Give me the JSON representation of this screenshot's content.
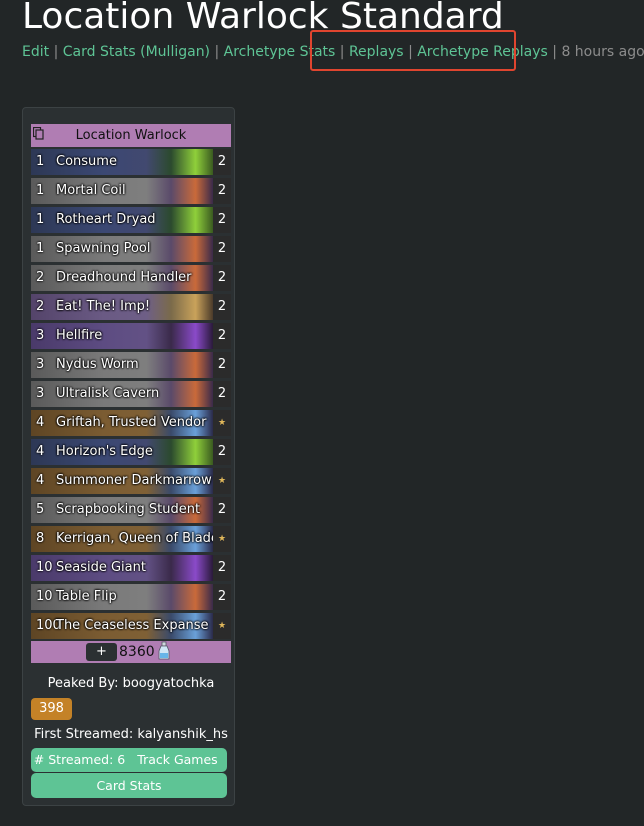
{
  "page": {
    "title": "Location Warlock Standard"
  },
  "links": {
    "edit": "Edit",
    "card_stats_mulligan": "Card Stats (Mulligan)",
    "archetype_stats": "Archetype Stats",
    "replays": "Replays",
    "archetype_replays": "Archetype Replays",
    "age": "8 hours ago",
    "separator": "|"
  },
  "deck": {
    "name": "Location Warlock",
    "copy_icon": "copy-icon",
    "cards": [
      {
        "cost": "1",
        "name": "Consume",
        "count": "2",
        "style": "warlock"
      },
      {
        "cost": "1",
        "name": "Mortal Coil",
        "count": "2",
        "style": "neutral"
      },
      {
        "cost": "1",
        "name": "Rotheart Dryad",
        "count": "2",
        "style": "warlock"
      },
      {
        "cost": "1",
        "name": "Spawning Pool",
        "count": "2",
        "style": "neutral"
      },
      {
        "cost": "2",
        "name": "Dreadhound Handler",
        "count": "2",
        "style": "neutral"
      },
      {
        "cost": "2",
        "name": "Eat! The! Imp!",
        "count": "2",
        "style": "zerg"
      },
      {
        "cost": "3",
        "name": "Hellfire",
        "count": "2",
        "style": "purple"
      },
      {
        "cost": "3",
        "name": "Nydus Worm",
        "count": "2",
        "style": "neutral"
      },
      {
        "cost": "3",
        "name": "Ultralisk Cavern",
        "count": "2",
        "style": "neutral"
      },
      {
        "cost": "4",
        "name": "Griftah, Trusted Vendor",
        "count": "★",
        "style": "legbar"
      },
      {
        "cost": "4",
        "name": "Horizon's Edge",
        "count": "2",
        "style": "warlock"
      },
      {
        "cost": "4",
        "name": "Summoner Darkmarrow",
        "count": "★",
        "style": "legbar"
      },
      {
        "cost": "5",
        "name": "Scrapbooking Student",
        "count": "2",
        "style": "neutral"
      },
      {
        "cost": "8",
        "name": "Kerrigan, Queen of Blades",
        "count": "★",
        "style": "legbar"
      },
      {
        "cost": "10",
        "name": "Seaside Giant",
        "count": "2",
        "style": "purple"
      },
      {
        "cost": "10",
        "name": "Table Flip",
        "count": "2",
        "style": "neutral"
      },
      {
        "cost": "100",
        "name": "The Ceaseless Expanse",
        "count": "★",
        "style": "legbar"
      }
    ],
    "add_button": "+",
    "dust_cost": "8360",
    "dust_icon": "dust-bottle-icon"
  },
  "stats": {
    "peaked_by": "Peaked By: boogyatochka",
    "rank": "398",
    "first_streamed": "First Streamed: kalyanshik_hs",
    "streamed_button": "# Streamed: 6",
    "track_games_button": "Track Games",
    "card_stats_button": "Card Stats"
  },
  "colors": {
    "link": "#5ec495",
    "highlight": "#e0452f",
    "deck_header": "#b07db3",
    "rank_badge": "#c48227"
  }
}
